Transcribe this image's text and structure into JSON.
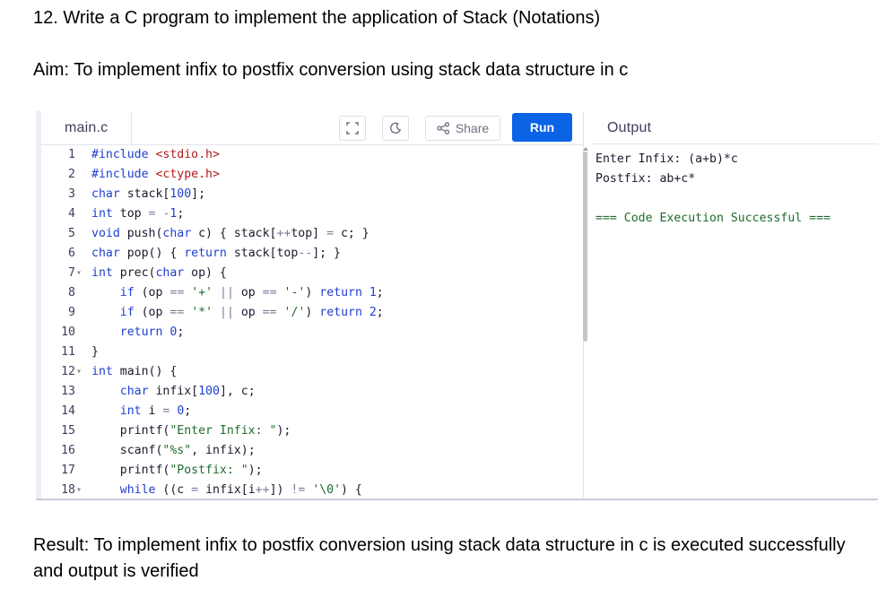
{
  "document": {
    "heading": "12. Write a C program to implement the application of Stack (Notations)",
    "aim": "Aim: To implement infix to postfix conversion using stack data structure in c",
    "result": "Result:  To implement infix to postfix conversion using stack data structure in c is executed successfully and output is verified"
  },
  "editor": {
    "file_tab": "main.c",
    "share_label": "Share",
    "run_label": "Run",
    "icons": [
      "fullscreen-icon",
      "moon-icon",
      "share-icon"
    ],
    "accent_color": "#0b63e5",
    "lines": [
      {
        "n": "1",
        "fold": "",
        "code": "#include <stdio.h>"
      },
      {
        "n": "2",
        "fold": "",
        "code": "#include <ctype.h>"
      },
      {
        "n": "3",
        "fold": "",
        "code": "char stack[100];"
      },
      {
        "n": "4",
        "fold": "",
        "code": "int top = -1;"
      },
      {
        "n": "5",
        "fold": "",
        "code": "void push(char c) { stack[++top] = c; }"
      },
      {
        "n": "6",
        "fold": "",
        "code": "char pop() { return stack[top--]; }"
      },
      {
        "n": "7",
        "fold": "▾",
        "code": "int prec(char op) {"
      },
      {
        "n": "8",
        "fold": "",
        "code": "    if (op == '+' || op == '-') return 1;"
      },
      {
        "n": "9",
        "fold": "",
        "code": "    if (op == '*' || op == '/') return 2;"
      },
      {
        "n": "10",
        "fold": "",
        "code": "    return 0;"
      },
      {
        "n": "11",
        "fold": "",
        "code": "}"
      },
      {
        "n": "12",
        "fold": "▾",
        "code": "int main() {"
      },
      {
        "n": "13",
        "fold": "",
        "code": "    char infix[100], c;"
      },
      {
        "n": "14",
        "fold": "",
        "code": "    int i = 0;"
      },
      {
        "n": "15",
        "fold": "",
        "code": "    printf(\"Enter Infix: \");"
      },
      {
        "n": "16",
        "fold": "",
        "code": "    scanf(\"%s\", infix);"
      },
      {
        "n": "17",
        "fold": "",
        "code": "    printf(\"Postfix: \");"
      },
      {
        "n": "18",
        "fold": "▾",
        "code": "    while ((c = infix[i++]) != '\\0') {"
      }
    ]
  },
  "output": {
    "title": "Output",
    "lines": [
      "Enter Infix: (a+b)*c",
      "Postfix: ab+c*",
      "",
      "=== Code Execution Successful ==="
    ]
  }
}
